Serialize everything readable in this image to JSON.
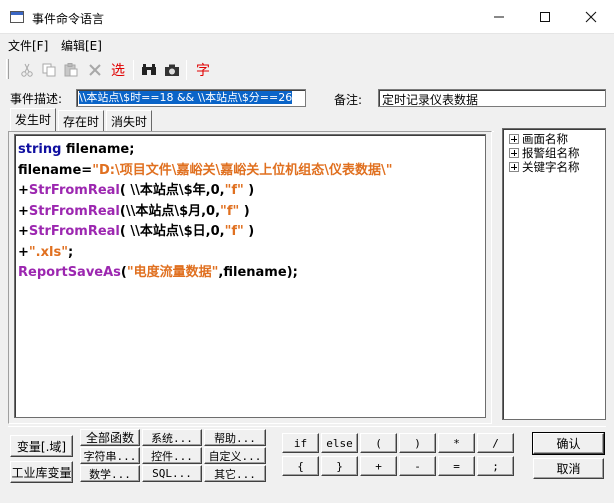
{
  "window": {
    "title": "事件命令语言",
    "minimize": "—",
    "maximize": "☐",
    "close": "✕"
  },
  "menu": {
    "file": "文件[F]",
    "edit": "编辑[E]"
  },
  "toolbar": {
    "select_label": "选",
    "char_label": "字"
  },
  "event_desc": {
    "label": "事件描述:",
    "value": "\\\\本站点\\$时==18 && \\\\本站点\\$分==26",
    "note_label": "备注:",
    "note_value": "定时记录仪表数据"
  },
  "tabs": [
    "发生时",
    "存在时",
    "消失时"
  ],
  "code_lines": [
    [
      {
        "t": "string",
        "c": "kw"
      },
      {
        "t": " filename;",
        "c": ""
      }
    ],
    [
      {
        "t": "filename=",
        "c": ""
      },
      {
        "t": "\"D:\\项目文件\\嘉峪关\\嘉峪关上位机组态\\仪表数据\\\"",
        "c": "str"
      }
    ],
    [
      {
        "t": "+",
        "c": ""
      },
      {
        "t": "StrFromReal",
        "c": "fn"
      },
      {
        "t": "( \\\\本站点\\$年,0,",
        "c": ""
      },
      {
        "t": "\"f\"",
        "c": "str"
      },
      {
        "t": " )",
        "c": ""
      }
    ],
    [
      {
        "t": "+",
        "c": ""
      },
      {
        "t": "StrFromReal",
        "c": "fn"
      },
      {
        "t": "(\\\\本站点\\$月,0,",
        "c": ""
      },
      {
        "t": "\"f\"",
        "c": "str"
      },
      {
        "t": " )",
        "c": ""
      }
    ],
    [
      {
        "t": "+",
        "c": ""
      },
      {
        "t": "StrFromReal",
        "c": "fn"
      },
      {
        "t": "( \\\\本站点\\$日,0,",
        "c": ""
      },
      {
        "t": "\"f\"",
        "c": "str"
      },
      {
        "t": " )",
        "c": ""
      }
    ],
    [
      {
        "t": "+",
        "c": ""
      },
      {
        "t": "\".xls\"",
        "c": "str"
      },
      {
        "t": ";",
        "c": ""
      }
    ],
    [
      {
        "t": "ReportSaveAs",
        "c": "fn"
      },
      {
        "t": "(",
        "c": ""
      },
      {
        "t": "\"电度流量数据\"",
        "c": "str"
      },
      {
        "t": ",filename);",
        "c": ""
      }
    ]
  ],
  "tree": [
    "画面名称",
    "报警组名称",
    "关键字名称"
  ],
  "bottom": {
    "var_domain": "变量[.域]",
    "ind_lib_var": "工业库变量",
    "all_funcs": "全部函数",
    "system": "系统...",
    "help": "帮助...",
    "string": "字符串...",
    "control": "控件...",
    "custom": "自定义...",
    "math": "数学...",
    "sql": "SQL...",
    "other": "其它...",
    "ops_row1": [
      "if",
      "else",
      "(",
      ")",
      "*",
      "/"
    ],
    "ops_row2": [
      "{",
      "}",
      "+",
      "-",
      "=",
      ";"
    ],
    "ok": "确认",
    "cancel": "取消"
  }
}
